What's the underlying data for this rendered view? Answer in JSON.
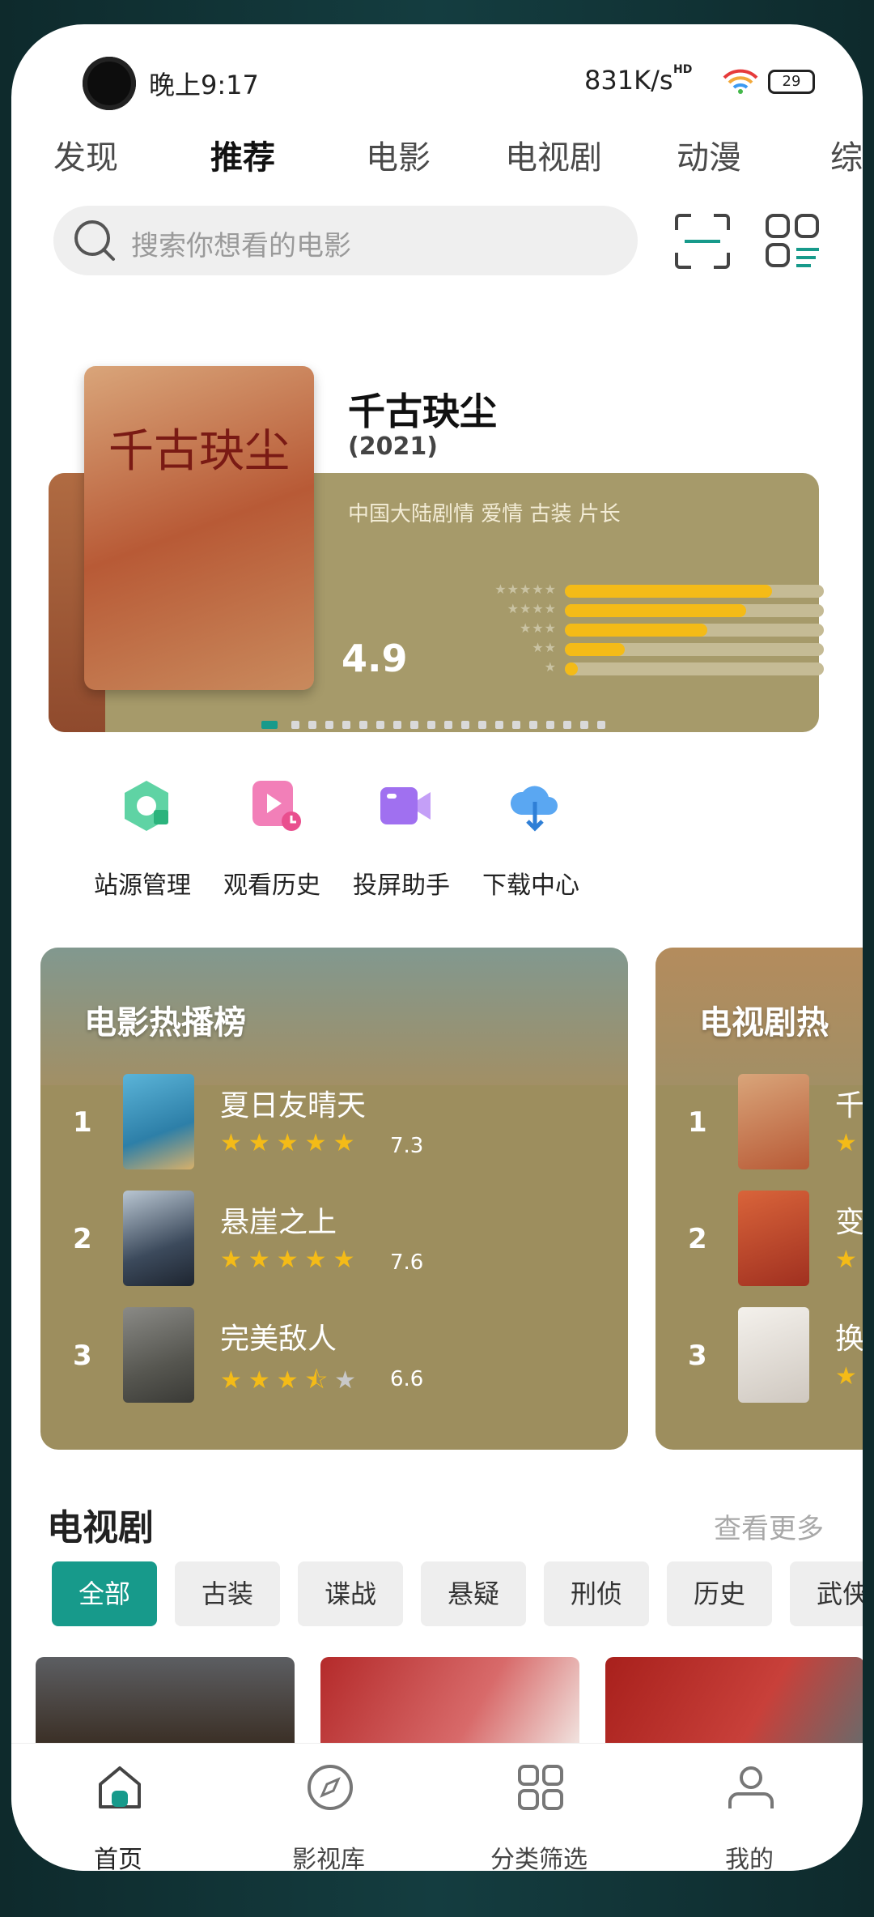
{
  "status": {
    "time": "晚上9:17",
    "speed": "831K/s",
    "hd": "HD",
    "battery": "29"
  },
  "categories": [
    "发现",
    "推荐",
    "电影",
    "电视剧",
    "动漫",
    "综"
  ],
  "search": {
    "placeholder": "搜索你想看的电影"
  },
  "featured": {
    "title": "千古玦尘",
    "year": "(2021)",
    "tags": "中国大陆剧情 爱情 古装 片长",
    "score": "4.9",
    "distribution": [
      0.8,
      0.7,
      0.55,
      0.23,
      0.05
    ],
    "poster_text": "千古玦尘"
  },
  "quick_actions": [
    "站源管理",
    "观看历史",
    "投屏助手",
    "下载中心"
  ],
  "rank_cards": [
    {
      "heading": "电影热播榜",
      "items": [
        {
          "num": "1",
          "name": "夏日友晴天",
          "score": "7.3",
          "stars": 5
        },
        {
          "num": "2",
          "name": "悬崖之上",
          "score": "7.6",
          "stars": 5
        },
        {
          "num": "3",
          "name": "完美敌人",
          "score": "6.6",
          "stars": 3.5
        }
      ]
    },
    {
      "heading": "电视剧热",
      "items": [
        {
          "num": "1",
          "name": "千"
        },
        {
          "num": "2",
          "name": "变"
        },
        {
          "num": "3",
          "name": "换"
        }
      ]
    }
  ],
  "tv_section": {
    "title": "电视剧",
    "more": "查看更多"
  },
  "chips": [
    "全部",
    "古装",
    "谍战",
    "悬疑",
    "刑侦",
    "历史",
    "武侠"
  ],
  "nav": [
    "首页",
    "影视库",
    "分类筛选",
    "我的"
  ],
  "colors": {
    "accent": "#179a8b",
    "star": "#f4bb17",
    "card": "#9d8e5e"
  }
}
